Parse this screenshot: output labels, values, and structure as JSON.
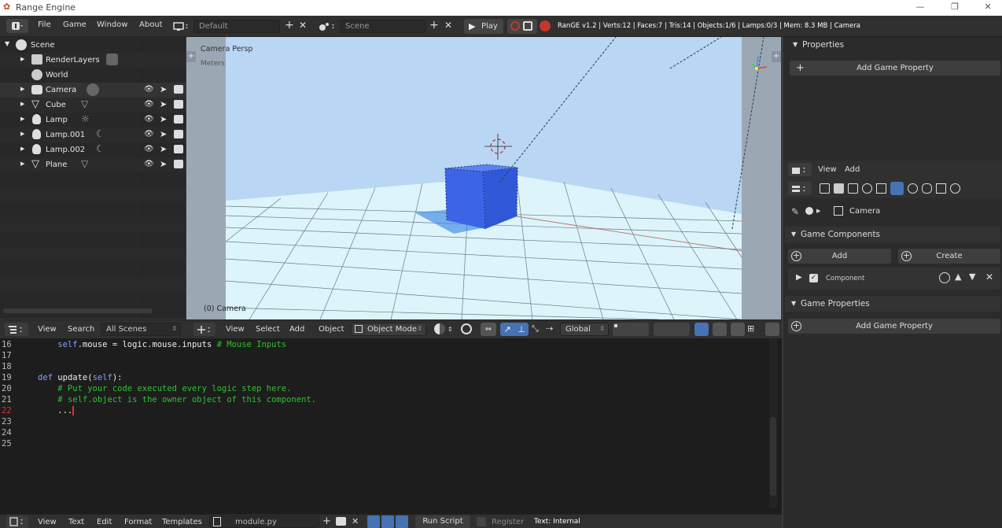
{
  "app": {
    "title": "Range Engine"
  },
  "window_controls": {
    "minimize": "—",
    "maximize": "❐",
    "close": "✕"
  },
  "menu": [
    "File",
    "Game",
    "Window",
    "About"
  ],
  "workspace": {
    "name": "Default",
    "add": "+",
    "close": "✕"
  },
  "scene_selector": {
    "name": "Scene",
    "add": "+",
    "close": "✕"
  },
  "play": {
    "label": "Play"
  },
  "stats": "RanGE v1.2 | Verts:12 | Faces:7 | Tris:14 | Objects:1/6 | Lamps:0/3 | Mem: 8.3 MB | Camera",
  "outliner": {
    "items": [
      {
        "label": "Scene",
        "icon": "scene-icon"
      },
      {
        "label": "RenderLayers",
        "icon": "render-layers-icon"
      },
      {
        "label": "World",
        "icon": "world-icon"
      },
      {
        "label": "Camera",
        "icon": "camera-icon"
      },
      {
        "label": "Cube",
        "icon": "mesh-icon"
      },
      {
        "label": "Lamp",
        "icon": "lamp-icon"
      },
      {
        "label": "Lamp.001",
        "icon": "lamp-icon"
      },
      {
        "label": "Lamp.002",
        "icon": "lamp-icon"
      },
      {
        "label": "Plane",
        "icon": "mesh-icon"
      }
    ],
    "header": {
      "view": "View",
      "search": "Search",
      "filter": "All Scenes"
    }
  },
  "viewport": {
    "camera_label": "Camera Persp",
    "units_label": "Meters",
    "object_label": "(0) Camera",
    "header": {
      "view": "View",
      "select": "Select",
      "add": "Add",
      "object": "Object",
      "mode": "Object Mode",
      "orientation": "Global"
    }
  },
  "code": {
    "lines": [
      {
        "n": "16",
        "t": "    self.mouse = logic.mouse.inputs # Mouse Inputs"
      },
      {
        "n": "17",
        "t": ""
      },
      {
        "n": "18",
        "t": ""
      },
      {
        "n": "19",
        "t": "def update(self):"
      },
      {
        "n": "20",
        "t": "    # Put your code executed every logic step here."
      },
      {
        "n": "21",
        "t": "    # self.object is the owner object of this component."
      },
      {
        "n": "22",
        "t": "    ..."
      },
      {
        "n": "23",
        "t": ""
      },
      {
        "n": "24",
        "t": ""
      },
      {
        "n": "25",
        "t": ""
      }
    ]
  },
  "text_editor": {
    "view": "View",
    "text": "Text",
    "edit": "Edit",
    "format": "Format",
    "templates": "Templates",
    "file": "module.py",
    "run": "Run Script",
    "register": "Register",
    "status": "Text: Internal"
  },
  "properties": {
    "title": "Properties",
    "add_game_property": "Add Game Property",
    "view": "View",
    "add": "Add",
    "object_name": "Camera",
    "game_components": "Game Components",
    "add_component": "Add",
    "create_component": "Create",
    "component_label": "Component",
    "game_properties": "Game Properties",
    "add_game_property2": "Add Game Property"
  },
  "colors": {
    "accent": "#4772b3",
    "play_red": "#c0392b",
    "cube": "#3c64e6",
    "sky": "#b9d6f4",
    "floor": "#dcf4fa"
  }
}
